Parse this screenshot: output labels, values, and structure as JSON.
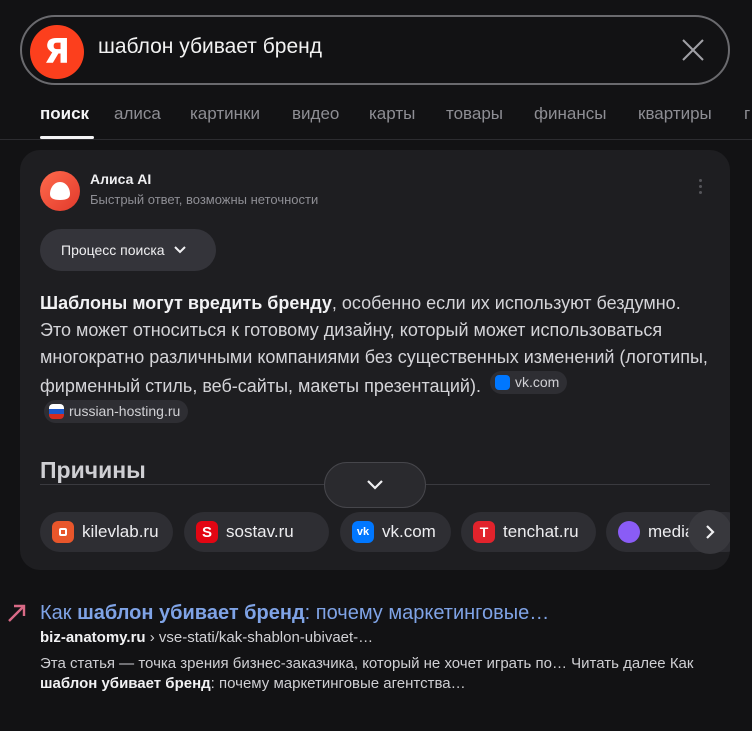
{
  "search": {
    "logo_letter": "Я",
    "query": "шаблон убивает бренд"
  },
  "tabs": [
    {
      "label": "поиск",
      "active": true
    },
    {
      "label": "алиса"
    },
    {
      "label": "картинки"
    },
    {
      "label": "видео"
    },
    {
      "label": "карты"
    },
    {
      "label": "товары"
    },
    {
      "label": "финансы"
    },
    {
      "label": "квартиры"
    },
    {
      "label": "г"
    }
  ],
  "alice": {
    "name": "Алиса AI",
    "subtitle": "Быстрый ответ, возможны неточности",
    "process_button": "Процесс поиска",
    "answer_bold": "Шаблоны могут вредить бренду",
    "answer_text": ", особенно если их используют бездумно. Это может относиться к готовому дизайну, который может использоваться многократно различными компаниями без существенных изменений (логотипы, фирменный стиль, веб-сайты, макеты презентаций).",
    "inline_sources": [
      {
        "label": "vk.com",
        "icon": "vk-icon",
        "color": "#0077ff"
      },
      {
        "label": "russian-hosting.ru",
        "icon": "russian-flag-icon",
        "color": "#d52b1e"
      }
    ],
    "reasons_heading": "Причины",
    "source_chips": [
      {
        "label": "kilevlab.ru",
        "icon": "kilevlab-icon",
        "color": "#e8562b"
      },
      {
        "label": "sostav.ru",
        "icon": "sostav-icon",
        "color": "#e30613"
      },
      {
        "label": "vk.com",
        "icon": "vk-icon",
        "color": "#0077ff"
      },
      {
        "label": "tenchat.ru",
        "icon": "tenchat-icon",
        "color": "#e2232c"
      },
      {
        "label": "mediam",
        "icon": "medium-icon",
        "color": "#8a5cf6"
      }
    ]
  },
  "result": {
    "title_prefix": "Как ",
    "title_bold": "шаблон убивает бренд",
    "title_suffix": ": почему маркетинговые…",
    "domain": "biz-anatomy.ru",
    "path": " › vse-stati/kak-shablon-ubivaet-…",
    "snippet_1": "Эта статья — точка зрения бизнес-заказчика, который не хочет играть по… Читать далее Как ",
    "snippet_bold": "шаблон убивает бренд",
    "snippet_2": ": почему маркетинговые агентства…"
  },
  "colors": {
    "background": "#121214",
    "card": "#1e1e21",
    "yandex_red": "#fc3f1d",
    "link": "#7fa3e6"
  }
}
